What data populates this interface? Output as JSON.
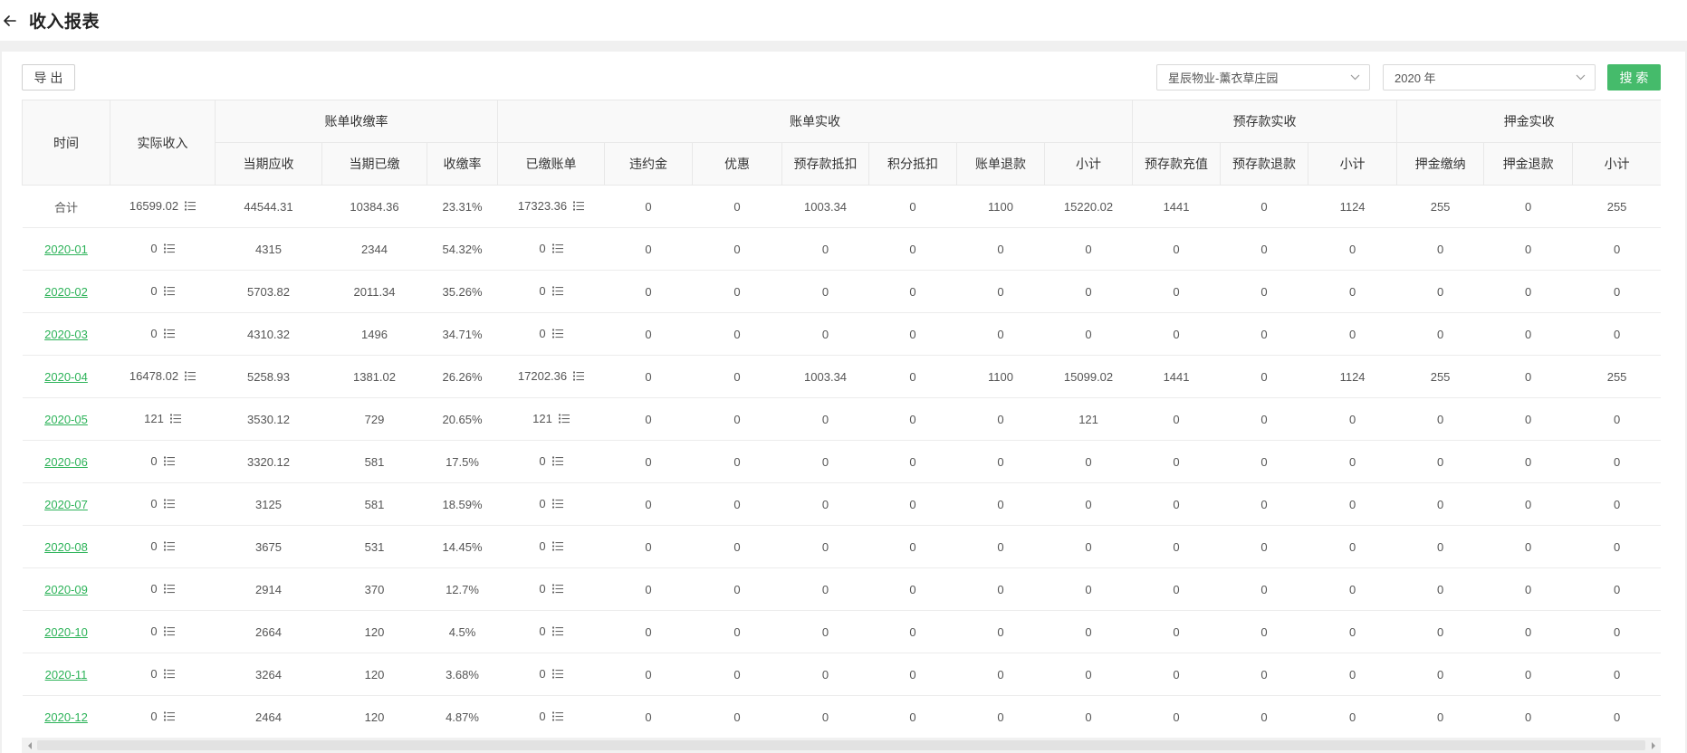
{
  "colors": {
    "link": "#2db359",
    "primary": "#45bb6b"
  },
  "header": {
    "back_icon": "arrow-left-icon",
    "title": "收入报表"
  },
  "toolbar": {
    "export_label": "导 出",
    "project_select": {
      "value": "星辰物业-薰衣草庄园",
      "icon": "chevron-down-icon"
    },
    "year_select": {
      "value": "2020 年",
      "icon": "chevron-down-icon"
    },
    "search_label": "搜 索"
  },
  "table": {
    "time_header": "时间",
    "actual_income": {
      "label": "实际收入",
      "cell_icon": "list-icon"
    },
    "groups": [
      {
        "label": "账单收缴率",
        "columns": [
          {
            "label": "当期应收"
          },
          {
            "label": "当期已缴"
          },
          {
            "label": "收缴率"
          }
        ]
      },
      {
        "label": "账单实收",
        "columns": [
          {
            "label": "已缴账单",
            "cell_icon": "list-icon"
          },
          {
            "label": "违约金"
          },
          {
            "label": "优惠"
          },
          {
            "label": "预存款抵扣"
          },
          {
            "label": "积分抵扣"
          },
          {
            "label": "账单退款"
          },
          {
            "label": "小计"
          }
        ]
      },
      {
        "label": "预存款实收",
        "columns": [
          {
            "label": "预存款充值"
          },
          {
            "label": "预存款退款"
          },
          {
            "label": "小计"
          }
        ]
      },
      {
        "label": "押金实收",
        "columns": [
          {
            "label": "押金缴纳"
          },
          {
            "label": "押金退款"
          },
          {
            "label": "小计"
          }
        ]
      }
    ],
    "rows": [
      {
        "time": "合计",
        "link": false,
        "cells": [
          "16599.02",
          "44544.31",
          "10384.36",
          "23.31%",
          "17323.36",
          "0",
          "0",
          "1003.34",
          "0",
          "1100",
          "15220.02",
          "1441",
          "0",
          "1124",
          "255",
          "0",
          "255"
        ]
      },
      {
        "time": "2020-01",
        "link": true,
        "cells": [
          "0",
          "4315",
          "2344",
          "54.32%",
          "0",
          "0",
          "0",
          "0",
          "0",
          "0",
          "0",
          "0",
          "0",
          "0",
          "0",
          "0",
          "0"
        ]
      },
      {
        "time": "2020-02",
        "link": true,
        "cells": [
          "0",
          "5703.82",
          "2011.34",
          "35.26%",
          "0",
          "0",
          "0",
          "0",
          "0",
          "0",
          "0",
          "0",
          "0",
          "0",
          "0",
          "0",
          "0"
        ]
      },
      {
        "time": "2020-03",
        "link": true,
        "cells": [
          "0",
          "4310.32",
          "1496",
          "34.71%",
          "0",
          "0",
          "0",
          "0",
          "0",
          "0",
          "0",
          "0",
          "0",
          "0",
          "0",
          "0",
          "0"
        ]
      },
      {
        "time": "2020-04",
        "link": true,
        "cells": [
          "16478.02",
          "5258.93",
          "1381.02",
          "26.26%",
          "17202.36",
          "0",
          "0",
          "1003.34",
          "0",
          "1100",
          "15099.02",
          "1441",
          "0",
          "1124",
          "255",
          "0",
          "255"
        ]
      },
      {
        "time": "2020-05",
        "link": true,
        "cells": [
          "121",
          "3530.12",
          "729",
          "20.65%",
          "121",
          "0",
          "0",
          "0",
          "0",
          "0",
          "121",
          "0",
          "0",
          "0",
          "0",
          "0",
          "0"
        ]
      },
      {
        "time": "2020-06",
        "link": true,
        "cells": [
          "0",
          "3320.12",
          "581",
          "17.5%",
          "0",
          "0",
          "0",
          "0",
          "0",
          "0",
          "0",
          "0",
          "0",
          "0",
          "0",
          "0",
          "0"
        ]
      },
      {
        "time": "2020-07",
        "link": true,
        "cells": [
          "0",
          "3125",
          "581",
          "18.59%",
          "0",
          "0",
          "0",
          "0",
          "0",
          "0",
          "0",
          "0",
          "0",
          "0",
          "0",
          "0",
          "0"
        ]
      },
      {
        "time": "2020-08",
        "link": true,
        "cells": [
          "0",
          "3675",
          "531",
          "14.45%",
          "0",
          "0",
          "0",
          "0",
          "0",
          "0",
          "0",
          "0",
          "0",
          "0",
          "0",
          "0",
          "0"
        ]
      },
      {
        "time": "2020-09",
        "link": true,
        "cells": [
          "0",
          "2914",
          "370",
          "12.7%",
          "0",
          "0",
          "0",
          "0",
          "0",
          "0",
          "0",
          "0",
          "0",
          "0",
          "0",
          "0",
          "0"
        ]
      },
      {
        "time": "2020-10",
        "link": true,
        "cells": [
          "0",
          "2664",
          "120",
          "4.5%",
          "0",
          "0",
          "0",
          "0",
          "0",
          "0",
          "0",
          "0",
          "0",
          "0",
          "0",
          "0",
          "0"
        ]
      },
      {
        "time": "2020-11",
        "link": true,
        "cells": [
          "0",
          "3264",
          "120",
          "3.68%",
          "0",
          "0",
          "0",
          "0",
          "0",
          "0",
          "0",
          "0",
          "0",
          "0",
          "0",
          "0",
          "0"
        ]
      },
      {
        "time": "2020-12",
        "link": true,
        "cells": [
          "0",
          "2464",
          "120",
          "4.87%",
          "0",
          "0",
          "0",
          "0",
          "0",
          "0",
          "0",
          "0",
          "0",
          "0",
          "0",
          "0",
          "0"
        ]
      }
    ]
  }
}
